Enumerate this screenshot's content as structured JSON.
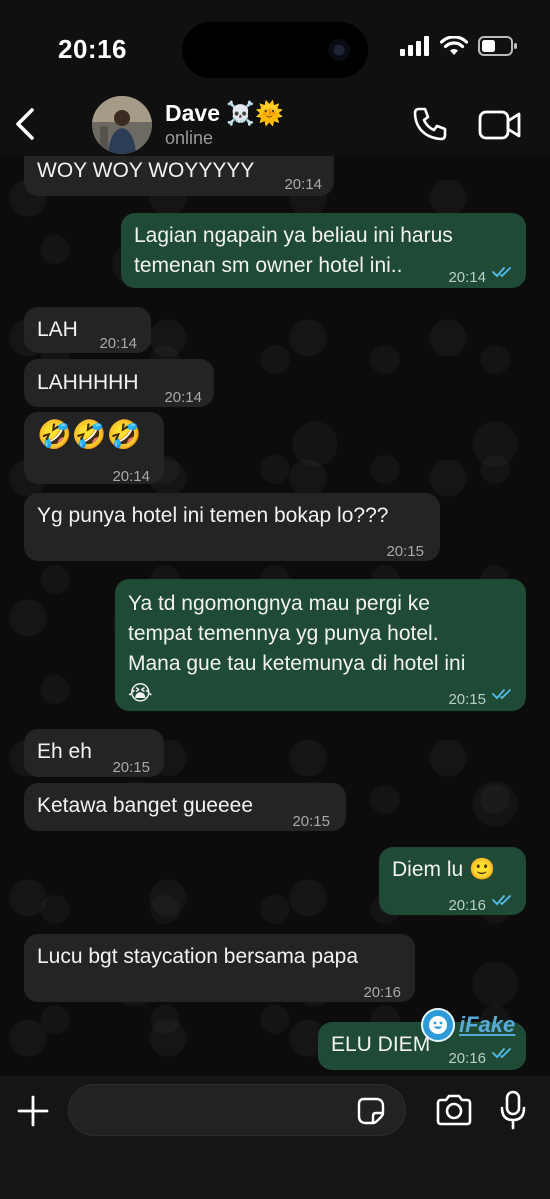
{
  "status_bar": {
    "time": "20:16"
  },
  "header": {
    "contact_name": "Dave ☠️🌞",
    "contact_status": "online",
    "icons": {
      "back": "chevron-left-icon",
      "call": "phone-icon",
      "video": "video-camera-icon"
    }
  },
  "messages": [
    {
      "dir": "in",
      "text": "WOY WOY WOYYYYY",
      "time": "20:14"
    },
    {
      "dir": "out",
      "lines": [
        "Lagian ngapain ya beliau ini harus",
        "temenan sm owner hotel ini.."
      ],
      "time": "20:14"
    },
    {
      "dir": "in",
      "text": "LAH",
      "time": "20:14"
    },
    {
      "dir": "in",
      "text": "LAHHHHH",
      "time": "20:14"
    },
    {
      "dir": "in",
      "text": "🤣🤣🤣",
      "time": "20:14"
    },
    {
      "dir": "in",
      "text": "Yg punya hotel ini temen bokap lo???",
      "time": "20:15"
    },
    {
      "dir": "out",
      "lines": [
        "Ya td ngomongnya mau pergi ke",
        "tempat temennya yg punya hotel.",
        "Mana gue tau ketemunya di hotel ini",
        "😭"
      ],
      "time": "20:15"
    },
    {
      "dir": "in",
      "text": "Eh eh",
      "time": "20:15"
    },
    {
      "dir": "in",
      "text": "Ketawa banget gueeee",
      "time": "20:15"
    },
    {
      "dir": "out",
      "text": "Diem lu 🙂",
      "time": "20:16"
    },
    {
      "dir": "in",
      "text": "Lucu bgt staycation bersama papa",
      "time": "20:16"
    },
    {
      "dir": "out",
      "text": "ELU DIEM",
      "time": "20:16"
    }
  ],
  "watermark": {
    "text": "iFake"
  },
  "input_bar": {
    "placeholder": "",
    "icons": {
      "attach": "plus-icon",
      "sticker": "sticker-icon",
      "camera": "camera-icon",
      "mic": "microphone-icon"
    }
  },
  "colors": {
    "incoming_bubble": "#242424",
    "outgoing_bubble": "#1f4a36",
    "read_ticks": "#53bdeb"
  }
}
